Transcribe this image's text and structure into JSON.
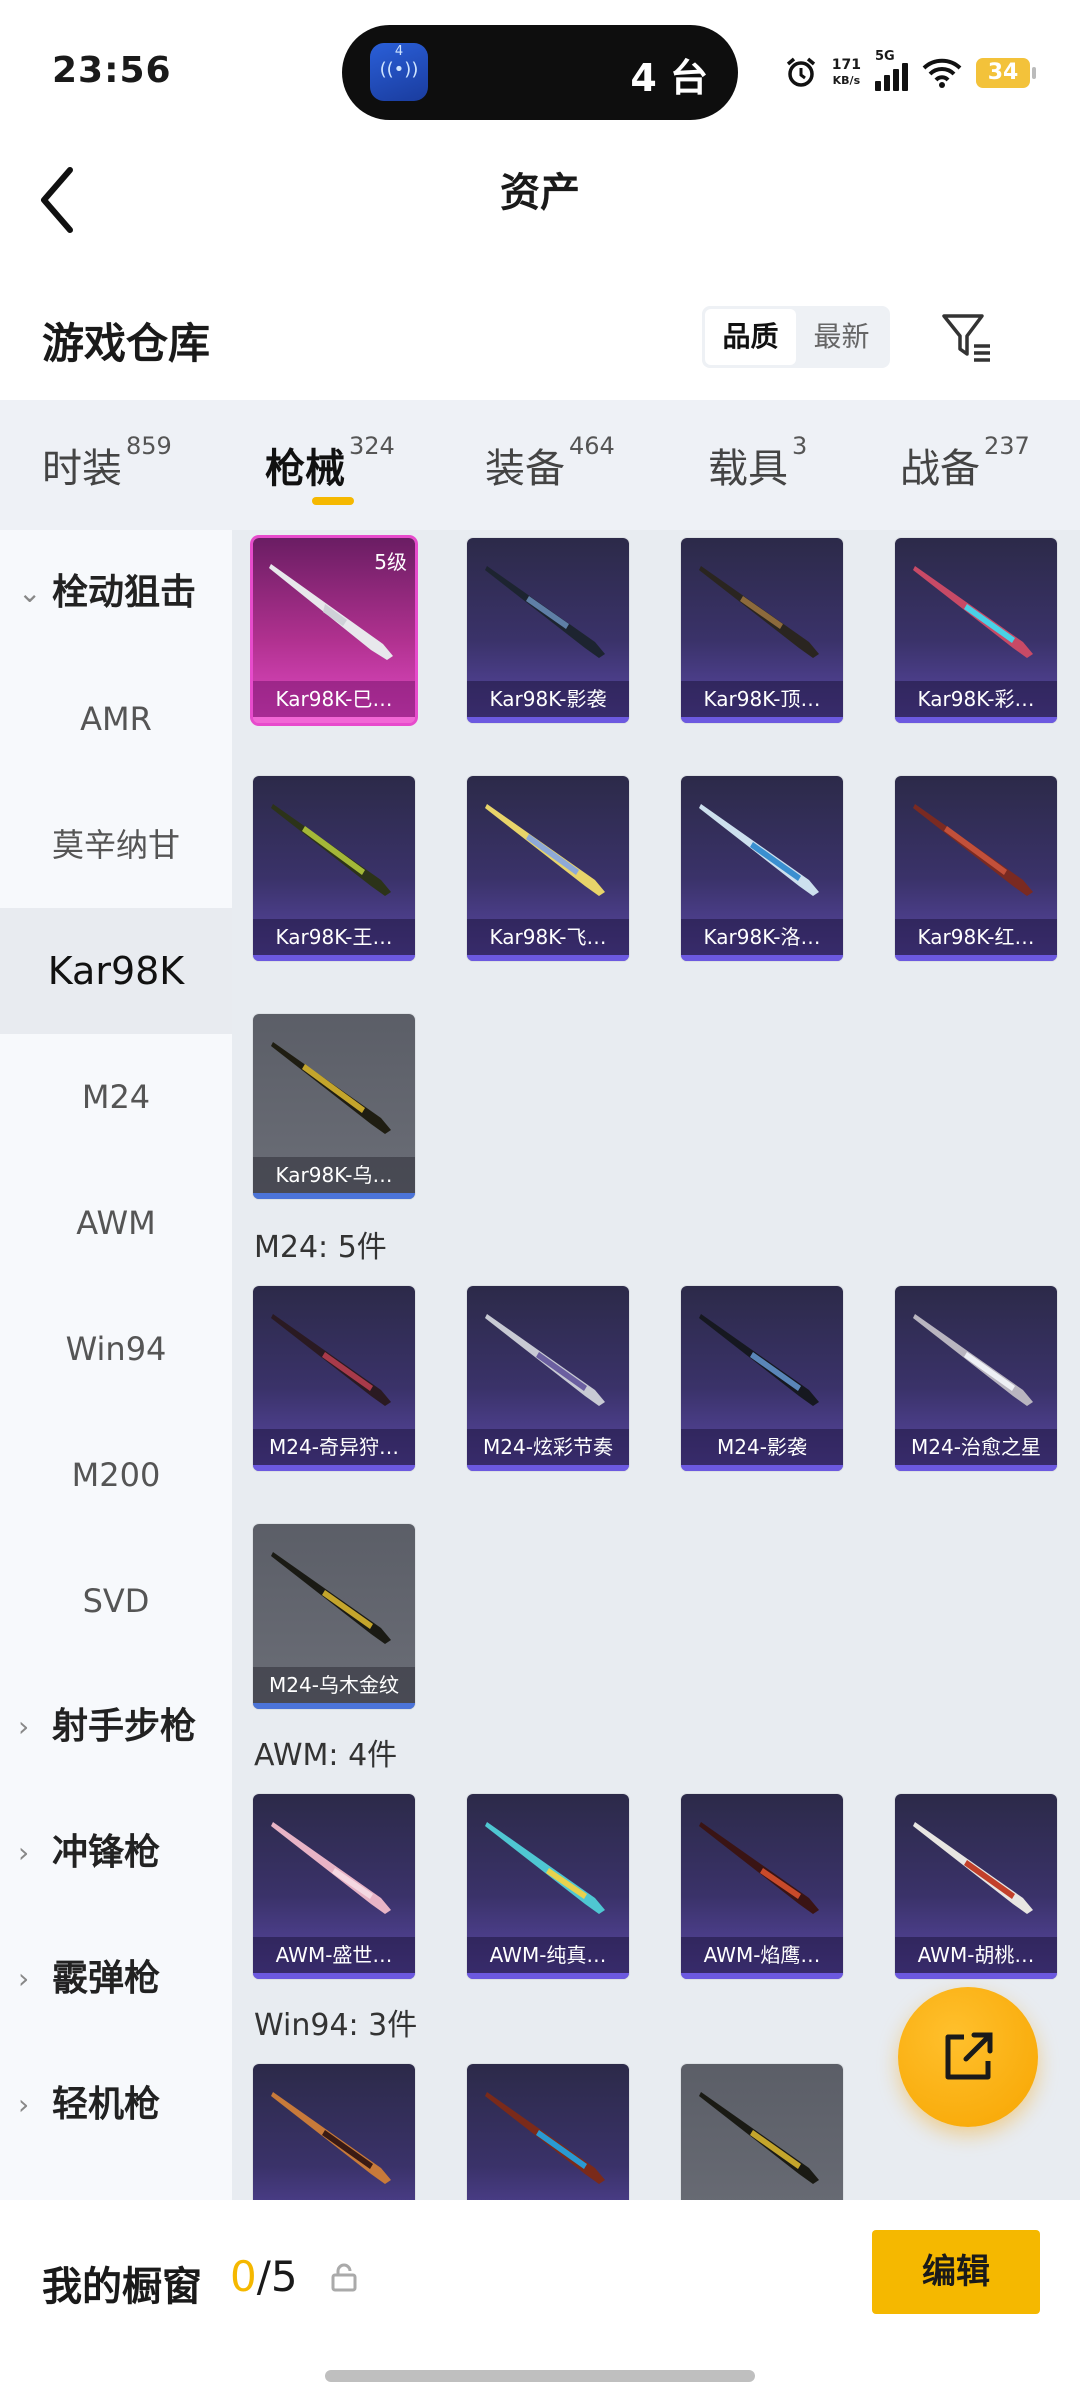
{
  "status": {
    "time": "23:56",
    "island_app_badge": "4",
    "island_count": "4 台",
    "net_speed": "171",
    "net_unit": "KB/s",
    "network": "5G",
    "battery": "34"
  },
  "header": {
    "title": "资产"
  },
  "warehouse": {
    "title": "游戏仓库",
    "sort_options": [
      "品质",
      "最新"
    ],
    "active_sort": "品质"
  },
  "tabs": [
    {
      "label": "时装",
      "count": "859"
    },
    {
      "label": "枪械",
      "count": "324"
    },
    {
      "label": "装备",
      "count": "464"
    },
    {
      "label": "载具",
      "count": "3"
    },
    {
      "label": "战备",
      "count": "237"
    }
  ],
  "active_tab": "枪械",
  "sidebar": [
    {
      "label": "栓动狙击",
      "type": "group"
    },
    {
      "label": "AMR"
    },
    {
      "label": "莫辛纳甘"
    },
    {
      "label": "Kar98K",
      "active": true
    },
    {
      "label": "M24"
    },
    {
      "label": "AWM"
    },
    {
      "label": "Win94"
    },
    {
      "label": "M200"
    },
    {
      "label": "SVD"
    },
    {
      "label": "射手步枪",
      "type": "group"
    },
    {
      "label": "冲锋枪",
      "type": "group"
    },
    {
      "label": "霰弹枪",
      "type": "group"
    },
    {
      "label": "轻机枪",
      "type": "group"
    }
  ],
  "sections": {
    "kar98k": {
      "items": [
        {
          "name": "Kar98K-巳…",
          "level": "5级",
          "rarity": "pink"
        },
        {
          "name": "Kar98K-影袭"
        },
        {
          "name": "Kar98K-顶…"
        },
        {
          "name": "Kar98K-彩…"
        },
        {
          "name": "Kar98K-王…"
        },
        {
          "name": "Kar98K-飞…"
        },
        {
          "name": "Kar98K-洛…"
        },
        {
          "name": "Kar98K-红…"
        },
        {
          "name": "Kar98K-乌…",
          "rarity": "gray"
        }
      ]
    },
    "m24": {
      "header": "M24: 5件",
      "items": [
        {
          "name": "M24-奇异狩…"
        },
        {
          "name": "M24-炫彩节奏"
        },
        {
          "name": "M24-影袭"
        },
        {
          "name": "M24-治愈之星"
        },
        {
          "name": "M24-乌木金纹",
          "rarity": "gray"
        }
      ]
    },
    "awm": {
      "header": "AWM: 4件",
      "items": [
        {
          "name": "AWM-盛世…"
        },
        {
          "name": "AWM-纯真…"
        },
        {
          "name": "AWM-焰鹰…"
        },
        {
          "name": "AWM-胡桃…"
        }
      ]
    },
    "win94": {
      "header": "Win94: 3件",
      "items": [
        {
          "name": ""
        },
        {
          "name": ""
        },
        {
          "name": "",
          "rarity": "gray"
        }
      ]
    }
  },
  "showcase": {
    "label": "我的橱窗",
    "count_current": "0",
    "count_total": "/5",
    "edit_label": "编辑"
  },
  "colors": {
    "accent": "#f5b800",
    "card_purple": "#5b49a8",
    "card_pink": "#e34ac6",
    "card_gray": "#6b6e77"
  },
  "icons": [
    "back-chevron-icon",
    "filter-icon",
    "share-external-icon",
    "lock-icon",
    "alarm-icon",
    "wifi-icon",
    "signal-icon"
  ]
}
